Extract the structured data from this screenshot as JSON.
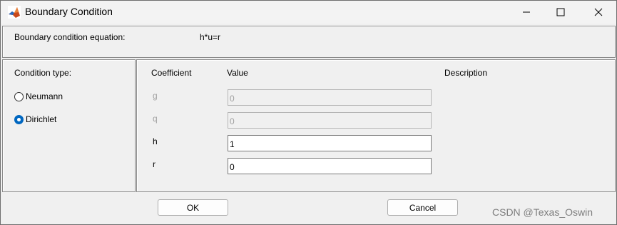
{
  "window": {
    "title": "Boundary Condition",
    "icon": "matlab-logo-icon",
    "controls": [
      "minimize-icon",
      "maximize-icon",
      "close-icon"
    ]
  },
  "equation": {
    "label": "Boundary condition equation:",
    "value": "h*u=r"
  },
  "condition_type": {
    "title": "Condition type:",
    "options": [
      {
        "label": "Neumann",
        "selected": false
      },
      {
        "label": "Dirichlet",
        "selected": true
      }
    ]
  },
  "coefficients": {
    "headers": {
      "coefficient": "Coefficient",
      "value": "Value",
      "description": "Description"
    },
    "rows": [
      {
        "name": "g",
        "value": "0",
        "enabled": false
      },
      {
        "name": "q",
        "value": "0",
        "enabled": false
      },
      {
        "name": "h",
        "value": "1",
        "enabled": true
      },
      {
        "name": "r",
        "value": "0",
        "enabled": true
      }
    ]
  },
  "buttons": {
    "ok": "OK",
    "cancel": "Cancel"
  },
  "watermark": "CSDN @Texas_Oswin",
  "colors": {
    "radio_selected": "#0067c0",
    "disabled_text": "#a0a0a0"
  }
}
